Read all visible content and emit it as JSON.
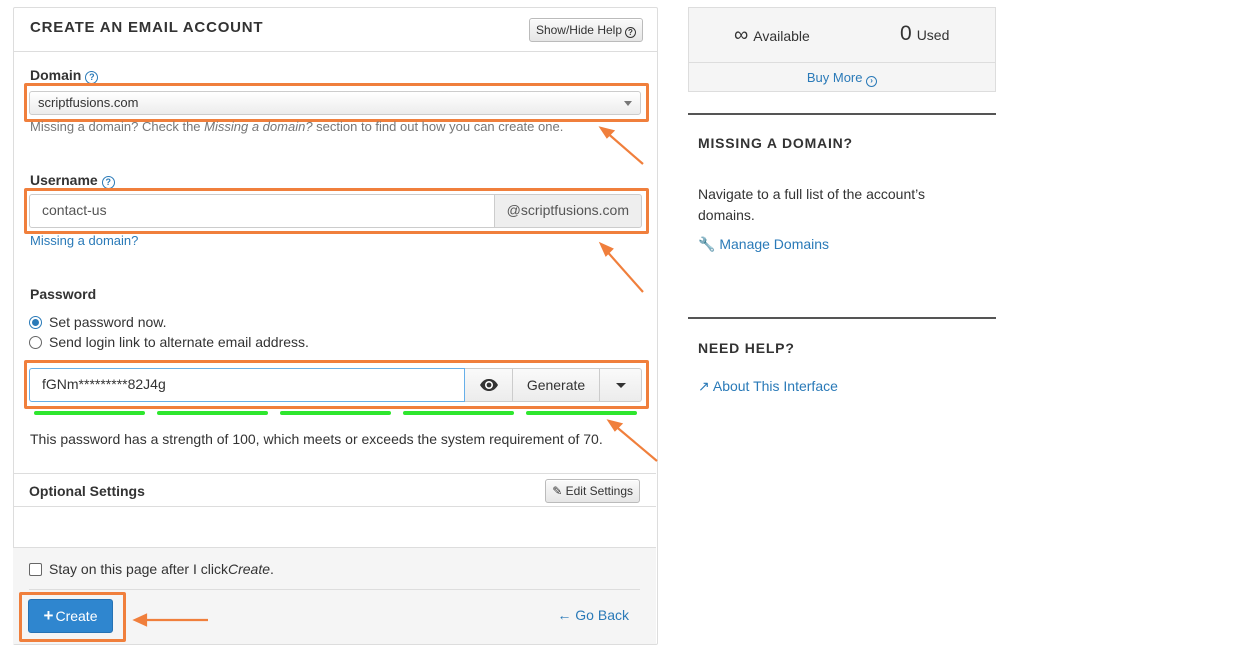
{
  "create_panel": {
    "title": "CREATE AN EMAIL ACCOUNT",
    "show_hide_help": "Show/Hide Help"
  },
  "domain": {
    "label": "Domain",
    "selected": "scriptfusions.com",
    "help_prefix": "Missing a domain? Check the ",
    "help_em": "Missing a domain?",
    "help_suffix": " section to find out how you can create one."
  },
  "username": {
    "label": "Username",
    "value": "contact-us",
    "suffix": "@scriptfusions.com",
    "missing_link": "Missing a domain?"
  },
  "password": {
    "label": "Password",
    "option_set_now": "Set password now.",
    "option_send_link": "Send login link to alternate email address.",
    "value": "fGNm*********82J4g",
    "generate_label": "Generate",
    "strength_text": "This password has a strength of 100, which meets or exceeds the system requirement of 70."
  },
  "optional": {
    "title": "Optional Settings",
    "edit_label": "Edit Settings"
  },
  "footer": {
    "stay_prefix": "Stay on this page after I click ",
    "stay_em": "Create",
    "stay_suffix": ".",
    "create_label": "Create",
    "go_back_label": "Go Back"
  },
  "stats": {
    "available_symbol": "∞",
    "available_label": "Available",
    "used_count": "0",
    "used_label": "Used",
    "buy_more": "Buy More"
  },
  "missing_domain": {
    "title": "MISSING A DOMAIN?",
    "text": "Navigate to a full list of the account’s domains.",
    "link": "Manage Domains"
  },
  "need_help": {
    "title": "NEED HELP?",
    "link": "About This Interface"
  },
  "colors": {
    "accent": "#2a7ab8",
    "primary_button": "#2f86cf",
    "annotation_orange": "#f07f3c",
    "strength_green": "#2ee62e"
  }
}
